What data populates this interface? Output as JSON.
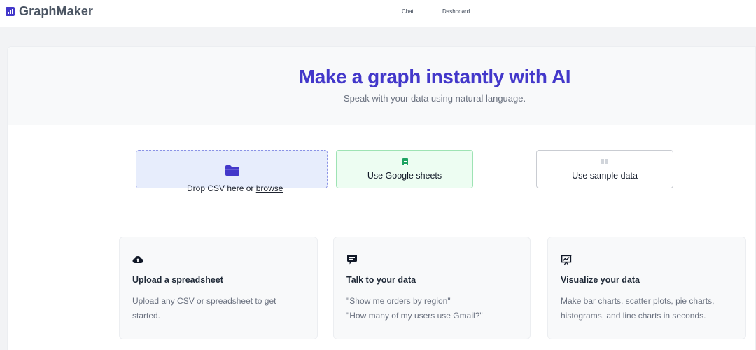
{
  "header": {
    "app_name": "GraphMaker",
    "nav": [
      {
        "label": "Chat"
      },
      {
        "label": "Dashboard"
      }
    ]
  },
  "hero": {
    "title": "Make a graph instantly with AI",
    "subtitle": "Speak with your data using natural language."
  },
  "data_sources": {
    "drop_csv": {
      "prefix": "Drop CSV here or ",
      "link": "browse",
      "icon": "folder-icon"
    },
    "google_sheets": {
      "label": "Use Google sheets",
      "icon": "google-sheets-icon"
    },
    "sample": {
      "label": "Use sample data",
      "icon": "table-icon"
    }
  },
  "features": [
    {
      "icon": "cloud-upload-icon",
      "title": "Upload a spreadsheet",
      "lines": [
        "Upload any CSV or spreadsheet to get",
        "started."
      ]
    },
    {
      "icon": "chat-bubble-icon",
      "title": "Talk to your data",
      "lines": [
        "\"Show me orders by region\"",
        "\"How many of my users use Gmail?\""
      ]
    },
    {
      "icon": "presentation-chart-icon",
      "title": "Visualize your data",
      "lines": [
        "Make bar charts, scatter plots, pie charts,",
        "histograms, and line charts in seconds."
      ]
    }
  ],
  "colors": {
    "brand": "#4338ca",
    "drop_bg": "#e7edfc",
    "sheets_bg": "#edfdf2",
    "sheets_green": "#1ea362"
  }
}
